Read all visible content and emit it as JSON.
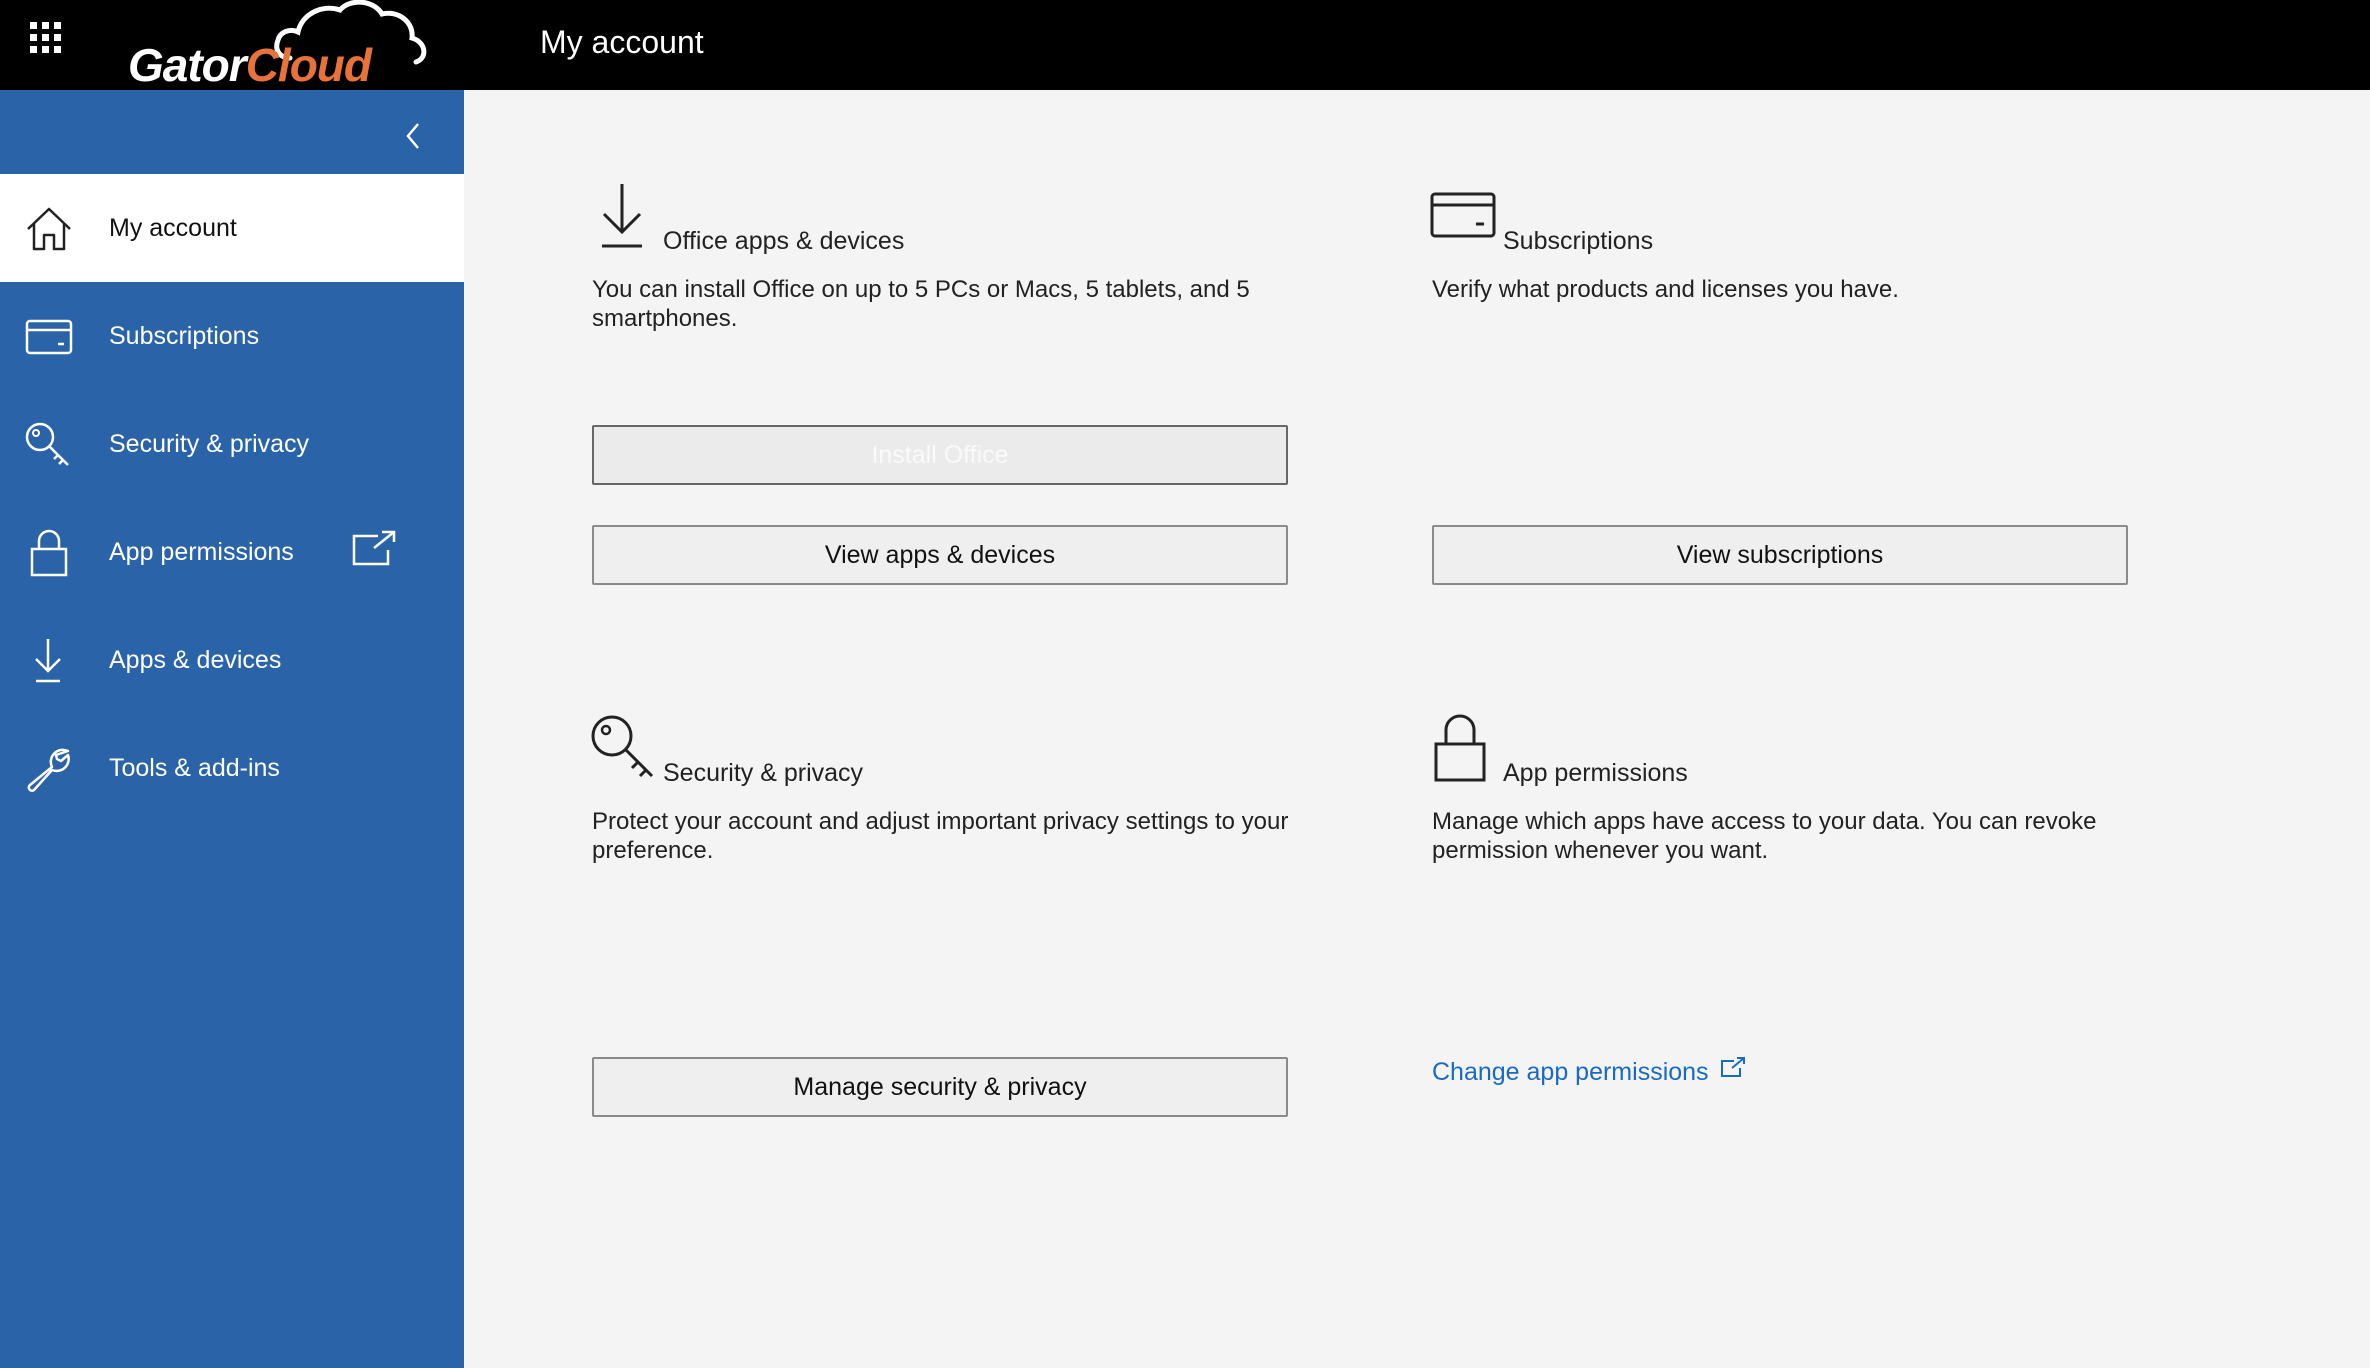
{
  "header": {
    "logo_part1": "Gator",
    "logo_part2": "Cloud",
    "title": "My account",
    "waffle_icon": "waffle-icon"
  },
  "sidebar": {
    "collapse_icon": "chevron-left-icon",
    "items": [
      {
        "label": "My account",
        "icon": "home-icon",
        "active": true
      },
      {
        "label": "Subscriptions",
        "icon": "card-icon"
      },
      {
        "label": "Security & privacy",
        "icon": "key-icon"
      },
      {
        "label": "App permissions",
        "icon": "lock-icon",
        "external_icon": "external-link-icon"
      },
      {
        "label": "Apps & devices",
        "icon": "download-icon"
      },
      {
        "label": "Tools & add-ins",
        "icon": "wrench-icon"
      }
    ]
  },
  "cards": {
    "office": {
      "title": "Office apps & devices",
      "desc": "You can install Office on up to 5 PCs or Macs, 5 tablets, and 5 smartphones.",
      "install_btn": "Install Office",
      "view_btn": "View apps & devices"
    },
    "subscriptions": {
      "title": "Subscriptions",
      "desc": "Verify what products and licenses you have.",
      "view_btn": "View subscriptions"
    },
    "security": {
      "title": "Security & privacy",
      "desc": "Protect your account and adjust important privacy settings to your preference.",
      "manage_btn": "Manage security & privacy"
    },
    "permissions": {
      "title": "App permissions",
      "desc": "Manage which apps have access to your data. You can revoke permission whenever you want.",
      "link": "Change app permissions"
    }
  },
  "colors": {
    "sidebar_bg": "#2a63a8",
    "topbar_bg": "#000000",
    "link": "#1a6ac2",
    "brand_orange": "#e8733a",
    "content_bg": "#f4f4f4"
  }
}
